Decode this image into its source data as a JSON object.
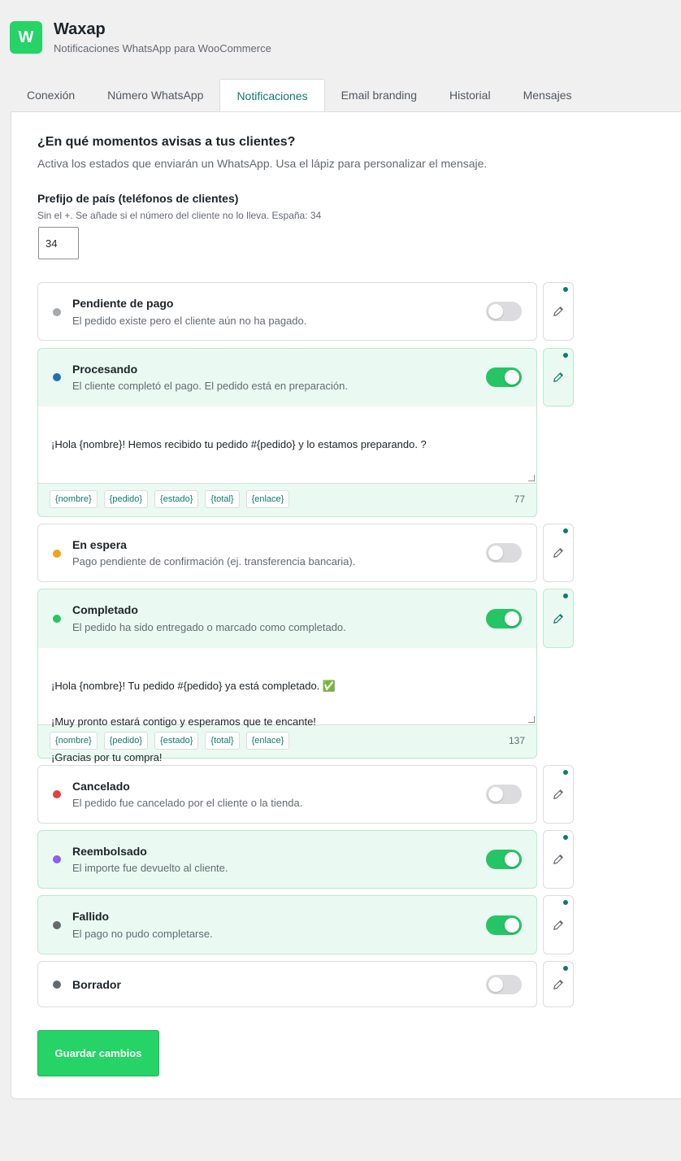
{
  "app": {
    "logo_letter": "W",
    "title": "Waxap",
    "subtitle": "Notificaciones WhatsApp para WooCommerce"
  },
  "tabs": [
    {
      "label": "Conexión"
    },
    {
      "label": "Número WhatsApp"
    },
    {
      "label": "Notificaciones",
      "active": true
    },
    {
      "label": "Email branding"
    },
    {
      "label": "Historial"
    },
    {
      "label": "Mensajes"
    }
  ],
  "section": {
    "title": "¿En qué momentos avisas a tus clientes?",
    "description": "Activa los estados que enviarán un WhatsApp. Usa el lápiz para personalizar el mensaje."
  },
  "prefix": {
    "label": "Prefijo de país (teléfonos de clientes)",
    "help": "Sin el +. Se añade si el número del cliente no lo lleva. España: 34",
    "value": "34"
  },
  "statuses": [
    {
      "title": "Pendiente de pago",
      "desc": "El pedido existe pero el cliente aún no ha pagado.",
      "dot_color": "#a7aaad",
      "enabled": false
    },
    {
      "title": "Procesando",
      "desc": "El cliente completó el pago. El pedido está en preparación.",
      "dot_color": "#2271b1",
      "enabled": true
    },
    {
      "title": "En espera",
      "desc": "Pago pendiente de confirmación (ej. transferencia bancaria).",
      "dot_color": "#f0a21b",
      "enabled": false
    },
    {
      "title": "Completado",
      "desc": "El pedido ha sido entregado o marcado como completado.",
      "dot_color": "#25c565",
      "enabled": true
    },
    {
      "title": "Cancelado",
      "desc": "El pedido fue cancelado por el cliente o la tienda.",
      "dot_color": "#e04141",
      "enabled": false
    },
    {
      "title": "Reembolsado",
      "desc": "El importe fue devuelto al cliente.",
      "dot_color": "#8b5cf6",
      "enabled": true
    },
    {
      "title": "Fallido",
      "desc": "El pago no pudo completarse.",
      "dot_color": "#646970",
      "enabled": true
    },
    {
      "title": "Borrador",
      "desc": "",
      "dot_color": "#646970",
      "enabled": false
    }
  ],
  "editors": {
    "procesando": {
      "message": "¡Hola {nombre}! Hemos recibido tu pedido #{pedido} y lo estamos preparando. ?",
      "count": "77"
    },
    "completado": {
      "message_line1": "¡Hola {nombre}! Tu pedido #{pedido} ya está completado. ✅",
      "message_line2": "¡Muy pronto estará contigo y esperamos que te encante!",
      "message_line3": "¡Gracias por tu compra!",
      "count": "137"
    }
  },
  "placeholders": [
    "{nombre}",
    "{pedido}",
    "{estado}",
    "{total}",
    "{enlace}"
  ],
  "save_label": "Guardar cambios"
}
